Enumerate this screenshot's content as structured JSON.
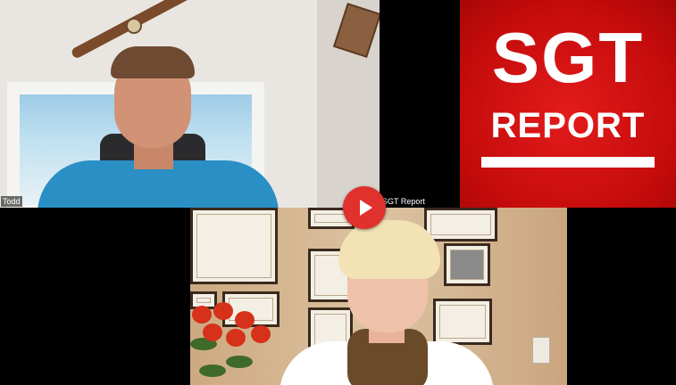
{
  "tiles": {
    "top_left": {
      "participant_name": "Todd"
    },
    "top_right": {
      "logo_line1": "SGT",
      "logo_line2": "REPORT",
      "participant_name": "SGT Report"
    }
  },
  "overlay": {
    "play_icon": "play-icon",
    "accent_color": "#e0312c"
  },
  "colors": {
    "logo_red": "#c40b0b",
    "background": "#000000"
  }
}
